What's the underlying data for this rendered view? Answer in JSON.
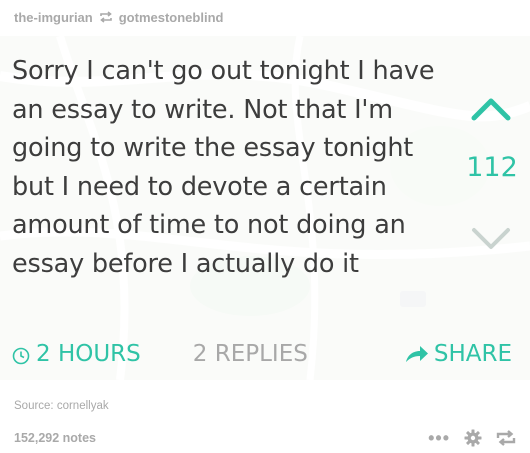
{
  "header": {
    "original_poster": "the-imgurian",
    "reblogger": "gotmestoneblind"
  },
  "post": {
    "text": "Sorry I can't go out tonight I have an essay to write. Not that I'm going to write the essay tonight but I need to devote a certain amount of time to not doing an essay before I actually do it",
    "vote_count": "112",
    "time": "2 HOURS",
    "replies": "2 REPLIES",
    "share": "SHARE"
  },
  "colors": {
    "accent": "#2fc3a6",
    "muted": "#a9a9a9",
    "text": "#3d3d3d"
  },
  "source": "Source: cornellyak",
  "notes": "152,292 notes",
  "icons": [
    "reblog-icon",
    "upvote-icon",
    "downvote-icon",
    "clock-icon",
    "share-arrow-icon",
    "more-icon",
    "gear-icon",
    "reblog-action-icon"
  ]
}
